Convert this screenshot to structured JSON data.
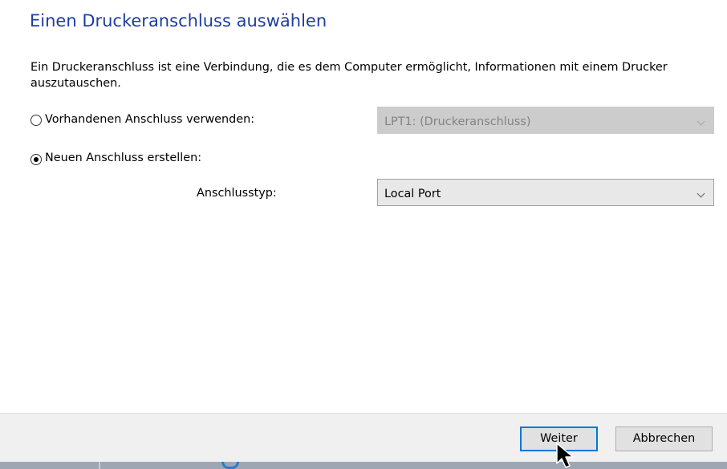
{
  "wizard": {
    "title": "Einen Druckeranschluss auswählen",
    "description": "Ein Druckeranschluss ist eine Verbindung, die es dem Computer ermöglicht, Informationen mit einem Drucker auszutauschen."
  },
  "existing_port": {
    "label": "Vorhandenen Anschluss verwenden:",
    "selected": false,
    "value": "LPT1: (Druckeranschluss)",
    "enabled": false
  },
  "new_port": {
    "label": "Neuen Anschluss erstellen:",
    "selected": true,
    "type_label": "Anschlusstyp:",
    "type_value": "Local Port"
  },
  "buttons": {
    "next": "Weiter",
    "cancel": "Abbrechen"
  },
  "colors": {
    "title": "#1f3d9c",
    "focus_border": "#0078d7",
    "taskbar": "#9ea6b4"
  },
  "icons": {
    "dropdown": "chevron-down-icon",
    "pointer": "mouse-cursor-icon"
  }
}
